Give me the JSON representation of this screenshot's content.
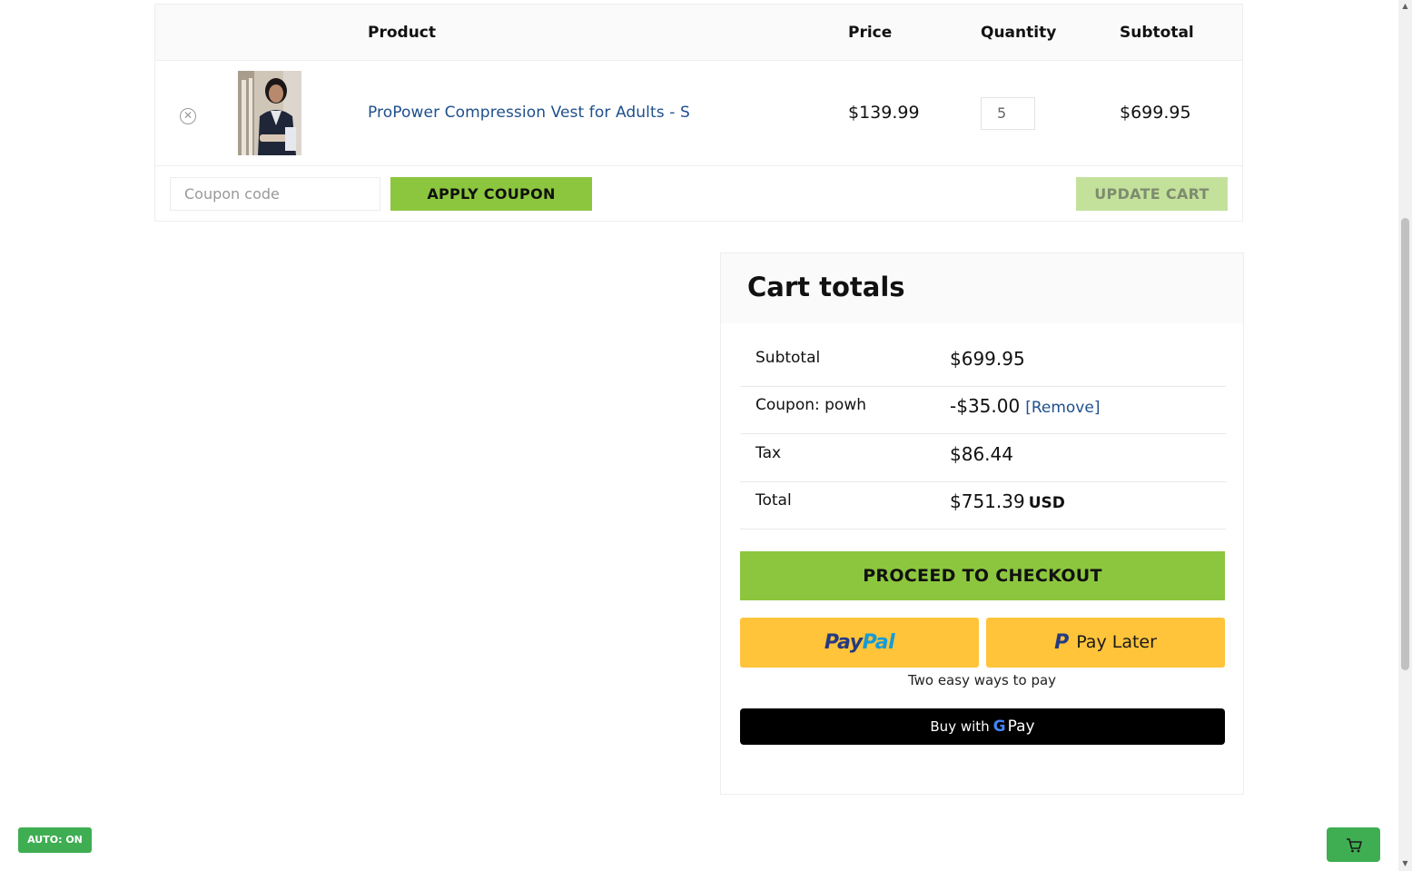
{
  "cart_table": {
    "headers": {
      "product": "Product",
      "price": "Price",
      "quantity": "Quantity",
      "subtotal": "Subtotal"
    },
    "items": [
      {
        "name": "ProPower Compression Vest for Adults - S",
        "price": "$139.99",
        "quantity": "5",
        "subtotal": "$699.95"
      }
    ],
    "coupon_placeholder": "Coupon code",
    "apply_coupon_label": "APPLY COUPON",
    "update_cart_label": "UPDATE CART"
  },
  "cart_totals": {
    "title": "Cart totals",
    "rows": [
      {
        "label": "Subtotal",
        "value": "$699.95"
      },
      {
        "label": "Coupon: powh",
        "value": "-$35.00",
        "action": "[Remove]"
      },
      {
        "label": "Tax",
        "value": "$86.44"
      },
      {
        "label": "Total",
        "value": "$751.39",
        "currency": "USD"
      }
    ],
    "checkout_label": "PROCEED TO CHECKOUT",
    "paypal": {
      "pay": "Pay",
      "pal": "Pal",
      "pay_later": "Pay Later",
      "tagline": "Two easy ways to pay"
    },
    "gpay": {
      "prefix": "Buy with",
      "g": "G",
      "pay": "Pay"
    }
  },
  "widgets": {
    "auto_label": "AUTO: ON"
  },
  "colors": {
    "accent_green": "#8cc63e",
    "link_blue": "#1e4f8c",
    "paypal_yellow": "#ffc43a",
    "widget_green": "#3fae52"
  }
}
